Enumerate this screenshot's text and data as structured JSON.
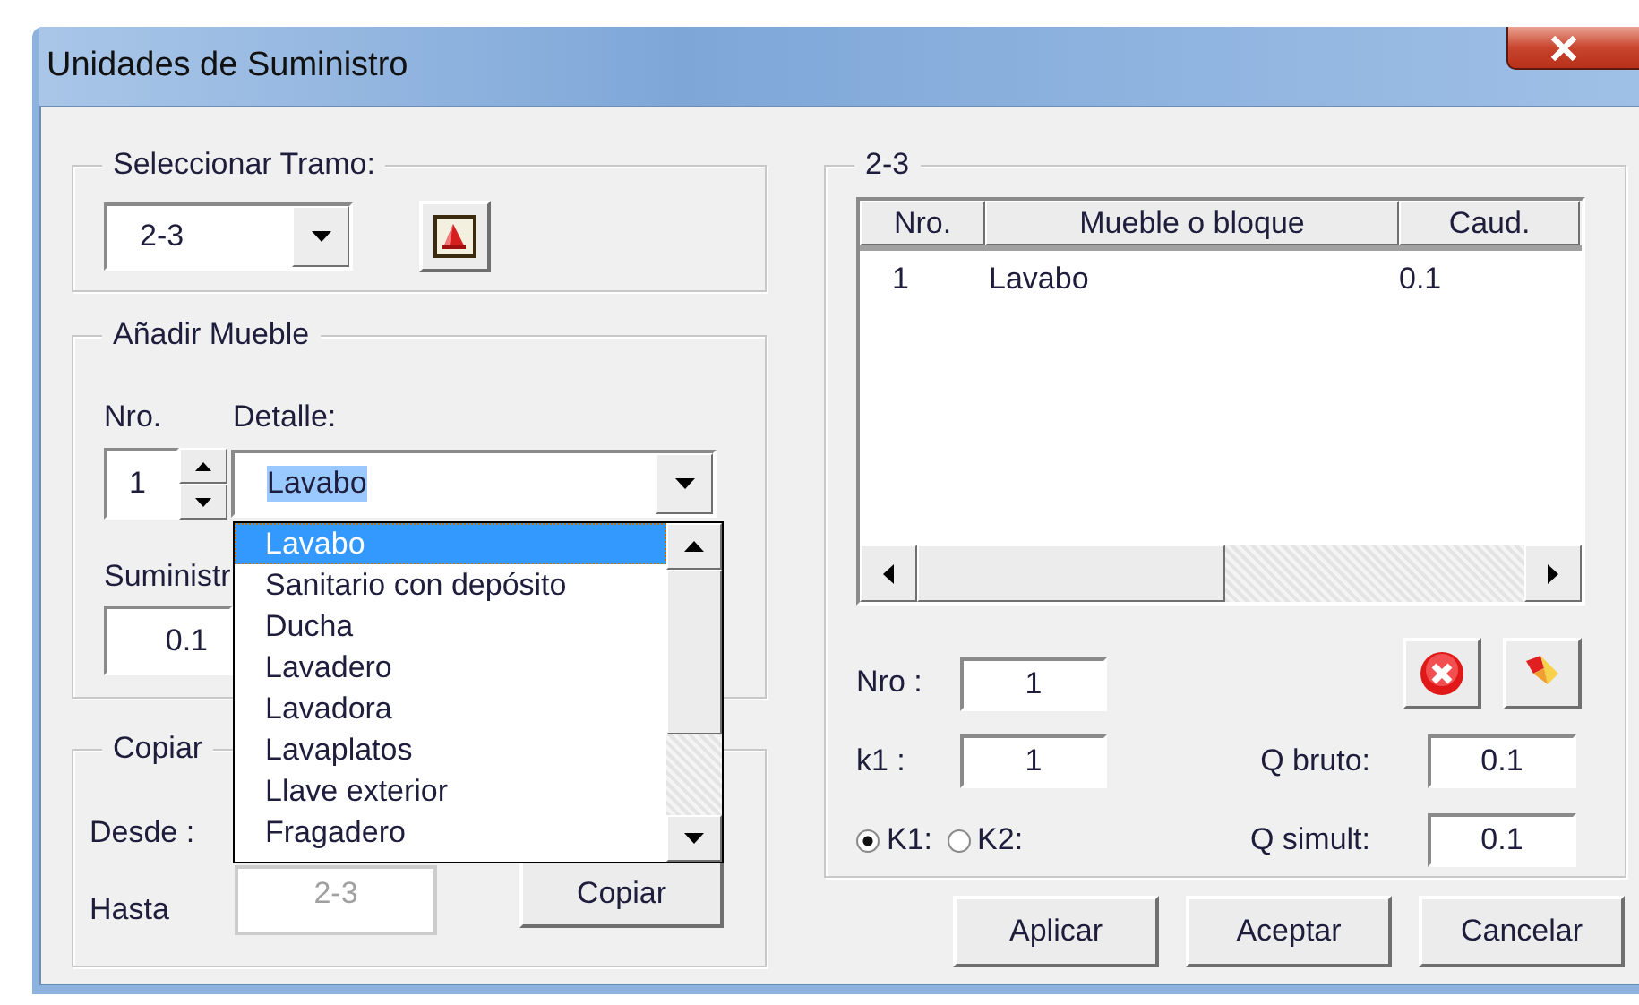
{
  "window": {
    "title": "Unidades de Suministro"
  },
  "seleccionar_tramo": {
    "label": "Seleccionar Tramo:",
    "value": "2-3"
  },
  "anadir_mueble": {
    "label": "Añadir Mueble",
    "nro_label": "Nro.",
    "detalle_label": "Detalle:",
    "nro": "1",
    "detalle": "Lavabo",
    "suministro_label": "Suministr",
    "suministro": "0.1"
  },
  "dropdown": {
    "items": [
      {
        "label": "Lavabo",
        "selected": true
      },
      {
        "label": "Sanitario con depósito",
        "selected": false
      },
      {
        "label": "Ducha",
        "selected": false
      },
      {
        "label": "Lavadero",
        "selected": false
      },
      {
        "label": "Lavadora",
        "selected": false
      },
      {
        "label": "Lavaplatos",
        "selected": false
      },
      {
        "label": "Llave exterior",
        "selected": false
      },
      {
        "label": "Fragadero",
        "selected": false
      }
    ]
  },
  "copiar": {
    "label": "Copiar",
    "desde_label": "Desde :",
    "hasta_label": "Hasta",
    "hasta": "2-3",
    "hasta_disabled": true,
    "button": "Copiar"
  },
  "tramo_panel": {
    "label": "2-3",
    "table": {
      "columns": [
        "Nro.",
        "Mueble o bloque",
        "Caud."
      ],
      "rows": [
        [
          "1",
          "Lavabo",
          "0.1"
        ]
      ]
    },
    "nro_label": "Nro :",
    "nro": "1",
    "k1_label": "k1 :",
    "k1": "1",
    "radios": [
      {
        "label": "K1:",
        "selected": true
      },
      {
        "label": "K2:",
        "selected": false
      }
    ],
    "q_bruto_label": "Q bruto:",
    "q_bruto": "0.1",
    "q_simult_label": "Q simult:",
    "q_simult": "0.1"
  },
  "buttons": [
    "Aplicar",
    "Aceptar",
    "Cancelar"
  ]
}
